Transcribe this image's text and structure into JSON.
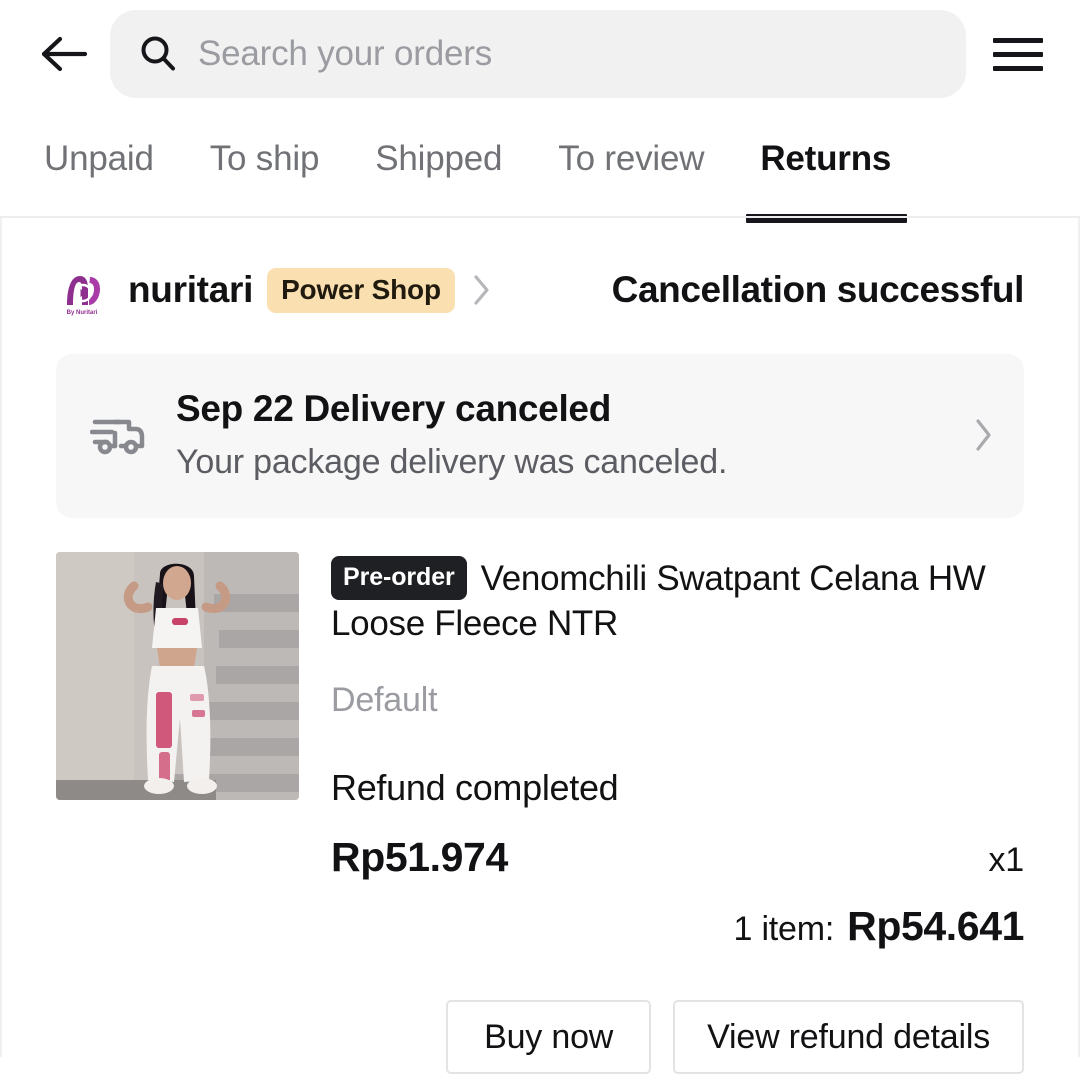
{
  "header": {
    "back_icon": "arrow-left-icon",
    "search_placeholder": "Search your orders",
    "search_value": "",
    "search_icon": "search-icon",
    "menu_icon": "hamburger-menu-icon"
  },
  "tabs": [
    {
      "label": "Unpaid",
      "active": false
    },
    {
      "label": "To ship",
      "active": false
    },
    {
      "label": "Shipped",
      "active": false
    },
    {
      "label": "To review",
      "active": false
    },
    {
      "label": "Returns",
      "active": true
    }
  ],
  "order": {
    "shop": {
      "logo_alt": "By Nuritari",
      "name": "nuritari",
      "badge": "Power Shop",
      "chevron_icon": "chevron-right-icon"
    },
    "status": "Cancellation successful",
    "delivery": {
      "icon": "delivery-truck-icon",
      "title": "Sep 22 Delivery canceled",
      "subtitle": "Your package delivery was canceled.",
      "chevron_icon": "chevron-right-icon"
    },
    "product": {
      "badge": "Pre-order",
      "title": "Venomchili Swatpant Celana HW Loose Fleece NTR",
      "variant": "Default",
      "refund_status": "Refund completed",
      "price": "Rp51.974",
      "quantity": "x1",
      "total_label": "1 item:",
      "total_value": "Rp54.641"
    },
    "actions": [
      {
        "label": "Buy now"
      },
      {
        "label": "View refund details"
      }
    ]
  },
  "colors": {
    "accent_badge_bg": "#FADFB0",
    "preorder_badge_bg": "#1F2024",
    "text_primary": "#121214",
    "text_secondary": "#5B5D63",
    "text_muted": "#9B9CA1",
    "search_bg": "#F1F1F2",
    "banner_bg": "#F7F7F8",
    "shop_logo_purple": "#8E2E8E"
  }
}
